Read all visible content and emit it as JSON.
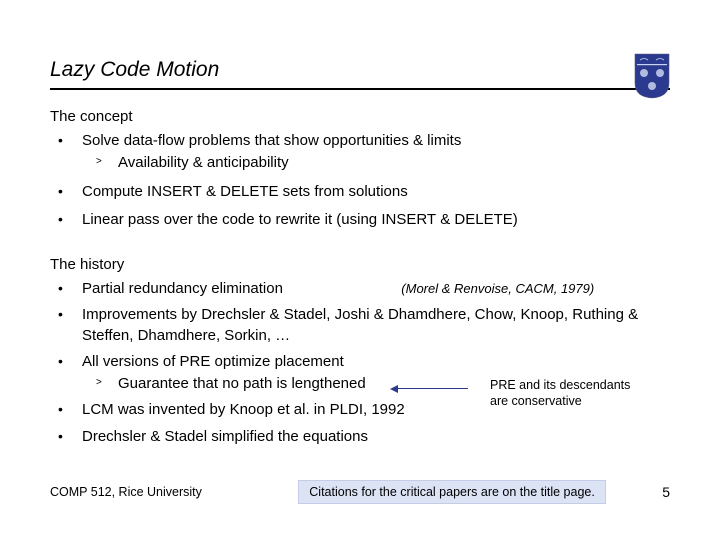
{
  "title": "Lazy Code Motion",
  "section1": {
    "label": "The concept",
    "items": [
      {
        "text": "Solve data-flow problems that show opportunities & limits",
        "sub": [
          "Availability & anticipability"
        ]
      },
      {
        "html": "Compute I<span class='sc'>NSERT</span> & D<span class='sc'>ELETE</span> sets from solutions"
      },
      {
        "html": "Linear pass over the code to rewrite it  (using I<span class='sc'>NSERT</span> & D<span class='sc'>ELETE</span>)"
      }
    ]
  },
  "section2": {
    "label": "The history",
    "items": [
      {
        "text": "Partial redundancy elimination",
        "cite": "(Morel & Renvoise, CACM, 1979)"
      },
      {
        "text": "Improvements by Drechsler & Stadel, Joshi & Dhamdhere, Chow, Knoop, Ruthing & Steffen, Dhamdhere, Sorkin, …"
      },
      {
        "text": "All versions of PRE optimize placement",
        "sub": [
          "Guarantee that no path is lengthened"
        ]
      },
      {
        "text": "LCM was invented by Knoop et al. in PLDI, 1992"
      },
      {
        "text": "Drechsler & Stadel simplified the equations"
      }
    ]
  },
  "note": {
    "line1": "PRE and its descendants",
    "line2": "are conservative"
  },
  "footer": {
    "left": "COMP 512, Rice University",
    "mid": "Citations for the critical papers are on the title page.",
    "right": "5"
  },
  "logo": {
    "name": "rice-owl-shield"
  }
}
